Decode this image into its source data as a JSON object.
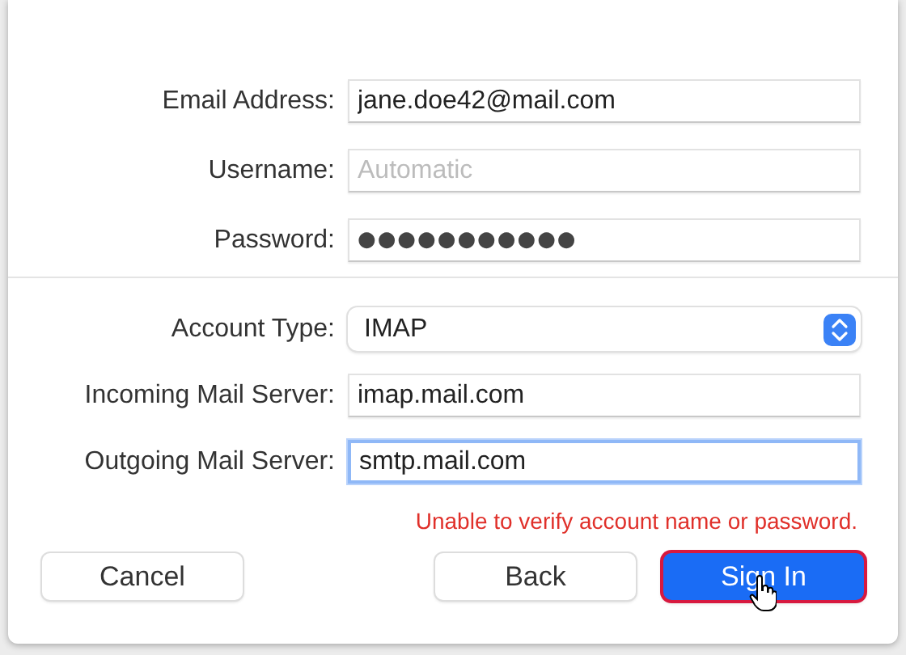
{
  "account_fields": [
    {
      "label": "Email Address:",
      "kind": "text",
      "value": "jane.doe42@mail.com"
    },
    {
      "label": "Username:",
      "kind": "text",
      "placeholder": "Automatic"
    },
    {
      "label": "Password:",
      "kind": "password",
      "value": "●●●●●●●●●●●"
    }
  ],
  "server_fields": [
    {
      "label": "Account Type:",
      "kind": "popup",
      "value": "IMAP",
      "focused": false
    },
    {
      "label": "Incoming Mail Server:",
      "kind": "text",
      "value": "imap.mail.com",
      "focused": false
    },
    {
      "label": "Outgoing Mail Server:",
      "kind": "text",
      "value": "smtp.mail.com",
      "focused": true
    }
  ],
  "error": "Unable to verify account name or password.",
  "buttons": [
    {
      "label": "Cancel",
      "default": false
    },
    {
      "label": "Back",
      "default": false
    },
    {
      "label": "Sign In",
      "default": true
    }
  ]
}
